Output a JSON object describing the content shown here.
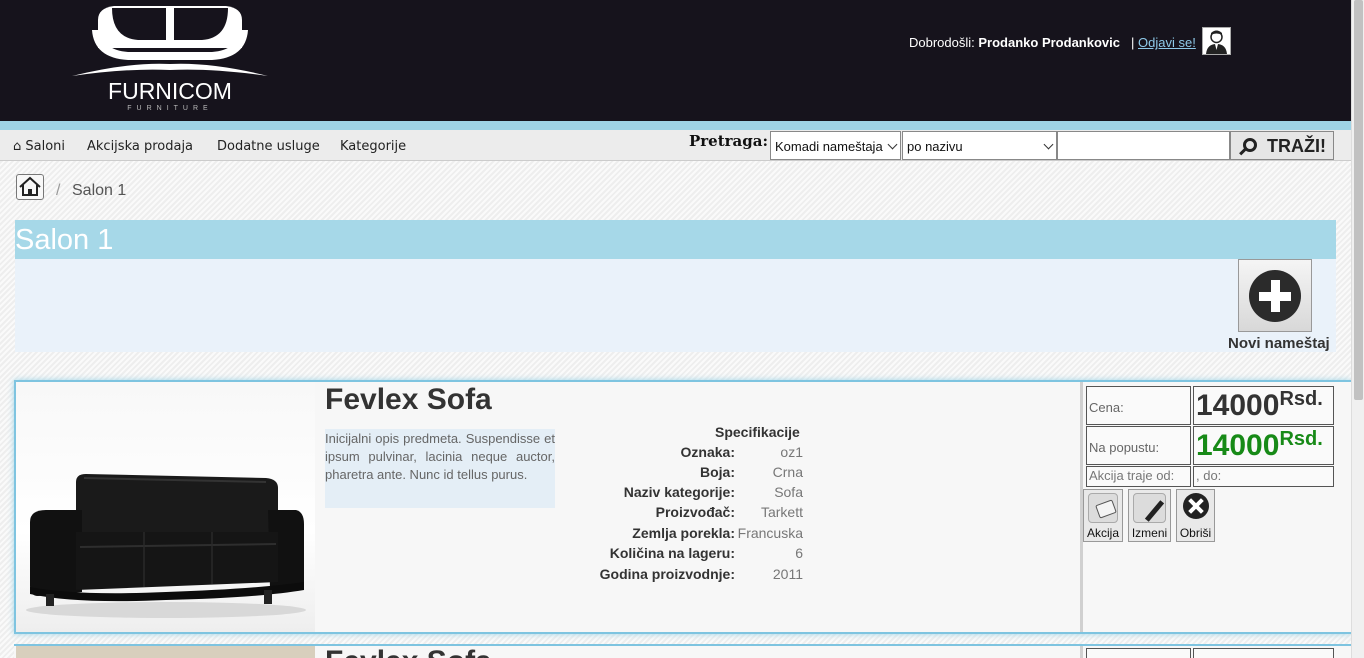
{
  "header": {
    "logo_text": "FURNICOM",
    "logo_sub": "FURNITURE",
    "welcome_prefix": "Dobrodošli:",
    "user_name": "Prodanko Prodankovic",
    "separator": "|",
    "logout_label": "Odjavi se!"
  },
  "nav": {
    "items": [
      {
        "label": "⌂ Saloni"
      },
      {
        "label": "Akcijska prodaja"
      },
      {
        "label": "Dodatne usluge"
      },
      {
        "label": "Kategorije"
      }
    ],
    "search_label": "Pretraga:",
    "category_select": "Komadi nameštaja",
    "mode_select": "po nazivu",
    "search_value": "",
    "search_button": "TRAŽI!"
  },
  "breadcrumb": {
    "separator": "/",
    "current": "Salon 1"
  },
  "page": {
    "title": "Salon 1",
    "new_item_label": "Novi nameštaj"
  },
  "product": {
    "name": "Fevlex Sofa",
    "description": "Inicijalni opis predmeta. Suspendisse et ipsum pulvinar, lacinia neque auctor, pharetra ante. Nunc id tellus purus.",
    "spec_title": "Specifikacije",
    "specs": [
      {
        "key": "Oznaka:",
        "value": "oz1"
      },
      {
        "key": "Boja:",
        "value": "Crna"
      },
      {
        "key": "Naziv kategorije:",
        "value": "Sofa"
      },
      {
        "key": "Proizvođač:",
        "value": "Tarkett"
      },
      {
        "key": "Zemlja porekla:",
        "value": "Francuska"
      },
      {
        "key": "Količina na lageru:",
        "value": "6"
      },
      {
        "key": "Godina proizvodnje:",
        "value": "2011"
      }
    ],
    "price_label": "Cena:",
    "price": "14000",
    "currency": "Rsd.",
    "discount_label": "Na popustu:",
    "discount_price": "14000",
    "sale_from_label": "Akcija traje od:",
    "sale_to_label": ", do:",
    "actions": {
      "sale": "Akcija",
      "edit": "Izmeni",
      "delete": "Obriši"
    },
    "colors": {
      "discount": "#178a17",
      "accent": "#a6d8e8"
    }
  },
  "next_product": {
    "name": "Fevlex Sofa"
  }
}
